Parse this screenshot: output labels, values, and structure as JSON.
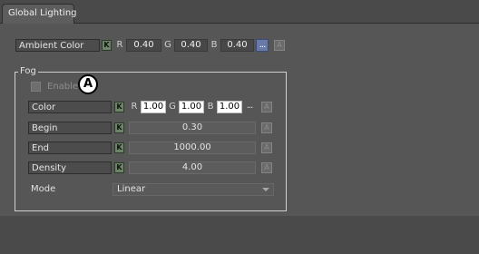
{
  "tab": {
    "label": "Global Lighting"
  },
  "ambient": {
    "label": "Ambient Color",
    "key_label": "K",
    "r_label": "R",
    "r_value": "0.40",
    "g_label": "G",
    "g_value": "0.40",
    "b_label": "B",
    "b_value": "0.40",
    "more_label": "...",
    "anim_label": "A"
  },
  "fog": {
    "title": "Fog",
    "enable_label": "Enable",
    "enabled": false,
    "callout": "A",
    "color": {
      "label": "Color",
      "key_label": "K",
      "r_label": "R",
      "r_value": "1.00",
      "g_label": "G",
      "g_value": "1.00",
      "b_label": "B",
      "b_value": "1.00",
      "more_label": "...",
      "anim_label": "A"
    },
    "begin": {
      "label": "Begin",
      "key_label": "K",
      "value": "0.30",
      "anim_label": "A"
    },
    "end": {
      "label": "End",
      "key_label": "K",
      "value": "1000.00",
      "anim_label": "A"
    },
    "density": {
      "label": "Density",
      "key_label": "K",
      "value": "4.00",
      "anim_label": "A"
    },
    "mode": {
      "label": "Mode",
      "value": "Linear"
    }
  }
}
